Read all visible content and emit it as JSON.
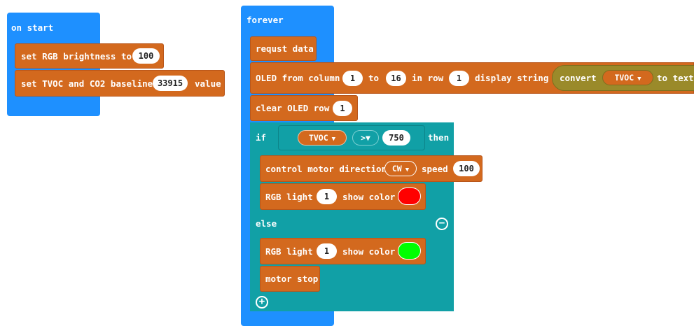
{
  "on_start": {
    "label": "on start",
    "set_rgb_brightness": {
      "label": "set RGB brightness to",
      "value": "100"
    },
    "set_baseline": {
      "label": "set TVOC and CO2 baseline",
      "value": "33915",
      "suffix": "value"
    }
  },
  "forever": {
    "label": "forever",
    "request_data": "requst data",
    "oled": {
      "from_column": "OLED from column",
      "col_start": "1",
      "to": "to",
      "col_end": "16",
      "in_row": "in row",
      "row": "1",
      "display_string": "display string",
      "convert": "convert",
      "sensor": "TVOC",
      "to_text": "to text"
    },
    "clear_oled": {
      "label": "clear OLED row",
      "row": "1"
    },
    "if_block": {
      "if": "if",
      "sensor": "TVOC",
      "operator": ">",
      "threshold": "750",
      "then": "then",
      "motor": {
        "label": "control motor direction",
        "direction": "CW",
        "speed_label": "speed",
        "speed": "100"
      },
      "rgb_then": {
        "label": "RGB light",
        "index": "1",
        "show_color": "show color",
        "color": "#ff0000"
      },
      "else": "else",
      "rgb_else": {
        "label": "RGB light",
        "index": "1",
        "show_color": "show color",
        "color": "#00ff00"
      },
      "motor_stop": "motor stop"
    }
  },
  "icons": {
    "remove": "minus-circle-icon",
    "add": "plus-circle-icon",
    "dropdown": "caret-down-icon"
  }
}
